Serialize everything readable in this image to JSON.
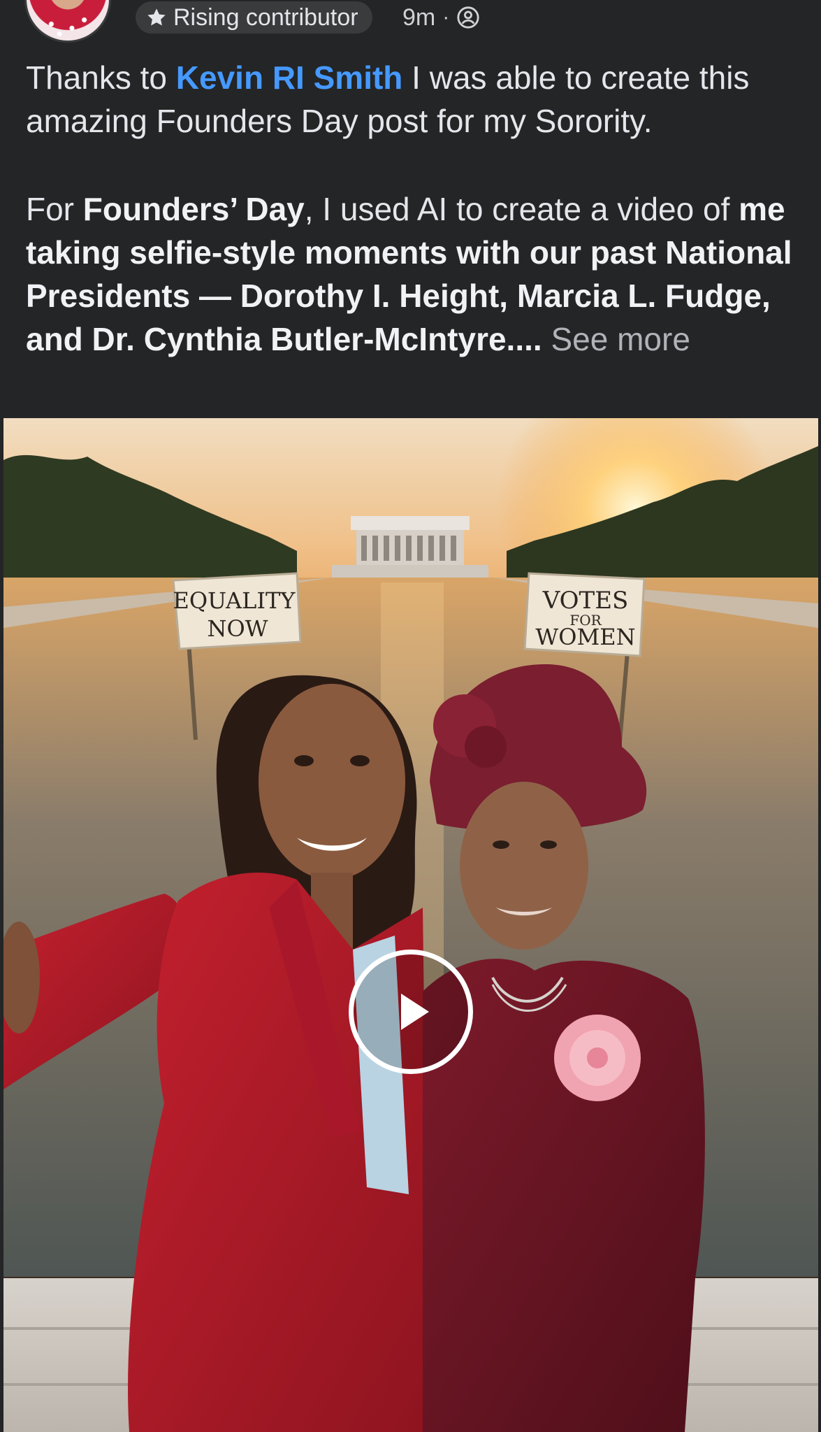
{
  "post_header": {
    "badge_label": "Rising contributor",
    "badge_icon": "star-icon",
    "timestamp": "9m",
    "separator": "·",
    "audience_icon": "globe-icon"
  },
  "post_body": {
    "p1_lead": "Thanks to ",
    "p1_mention": "Kevin RI Smith",
    "p1_tail": " I was able to create this amazing Founders Day post for my Sorority.",
    "p2_lead": "For ",
    "p2_bold_1": "Founders’ Day",
    "p2_mid": ", I used AI to create a video of ",
    "p2_bold_2": "me taking selfie-style moments with our past National Presidents — Dorothy I. Height, Marcia L. Fudge, and Dr. Cynthia Butler-McIntyre.",
    "p2_ellipsis": "...",
    "see_more": " See more"
  },
  "media": {
    "sign_left_line1": "EQUALITY",
    "sign_left_line2": "NOW",
    "sign_right_line1": "VOTES",
    "sign_right_line2": "FOR",
    "sign_right_line3": "WOMEN",
    "play_icon": "play-icon"
  },
  "colors": {
    "background": "#242526",
    "mention": "#4599ff",
    "badge_bg": "#3a3b3c"
  }
}
